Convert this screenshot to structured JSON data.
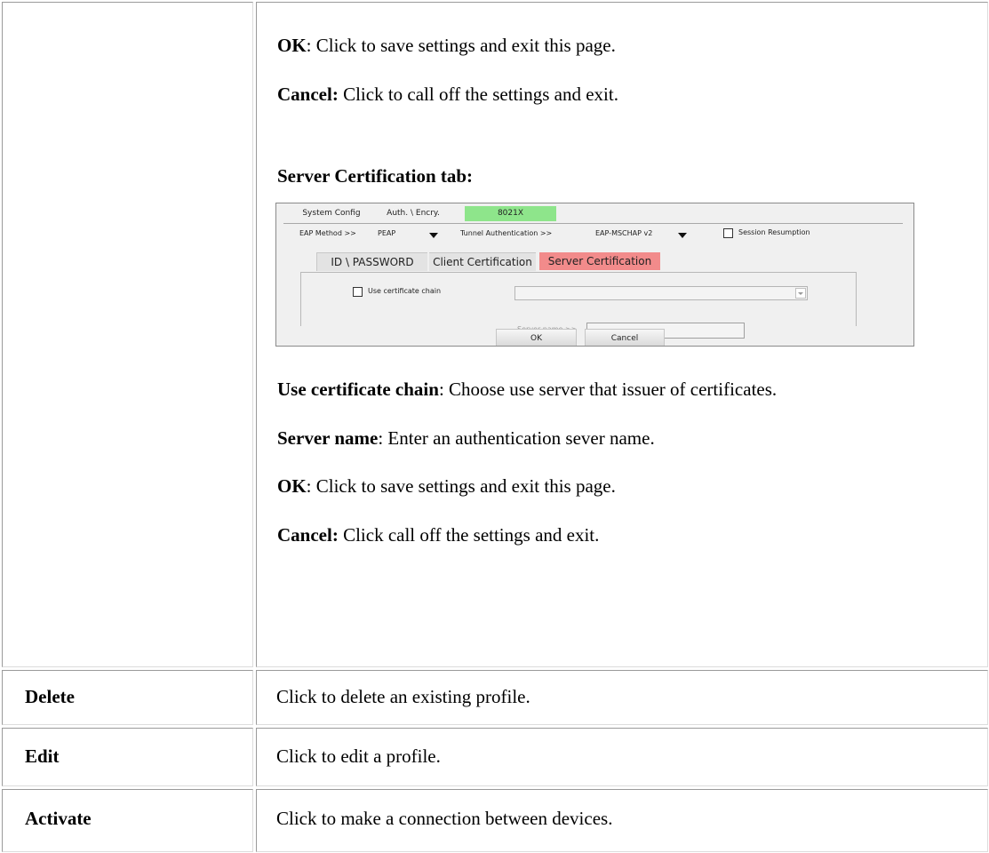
{
  "top_section": {
    "paragraphs": [
      {
        "term": "OK",
        "text": ": Click to save settings and exit this page."
      },
      {
        "term": "Cancel:",
        "text": " Click to call off the settings and exit."
      }
    ],
    "heading": "Server Certification tab:"
  },
  "dialog": {
    "tabs": [
      "System Config",
      "Auth. \\ Encry.",
      "8021X"
    ],
    "active_tab_color": "#8ee58b",
    "eap_method_label": "EAP Method >>",
    "eap_method_value": "PEAP",
    "tunnel_auth_label": "Tunnel Authentication >>",
    "tunnel_auth_value": "EAP-MSCHAP v2",
    "session_resumption_label": "Session Resumption",
    "sub_tabs": [
      "ID \\ PASSWORD",
      "Client Certification",
      "Server Certification"
    ],
    "active_sub_tab_color": "#f28b8b",
    "use_cert_chain_label": "Use certificate chain",
    "server_name_label": "Server name >>",
    "ok_label": "OK",
    "cancel_label": "Cancel"
  },
  "bottom_section": {
    "paragraphs": [
      {
        "term": "Use certificate chain",
        "text": ": Choose use server that issuer of certificates."
      },
      {
        "term": "Server name",
        "text": ": Enter an authentication sever name."
      },
      {
        "term": "OK",
        "text": ": Click to save settings and exit this page."
      },
      {
        "term": "Cancel:",
        "text": " Click call off the settings and exit."
      }
    ]
  },
  "rows": [
    {
      "label": "Delete",
      "description": "Click to delete an existing profile."
    },
    {
      "label": "Edit",
      "description": "Click to edit a profile."
    },
    {
      "label": "Activate",
      "description": "Click to make a connection between devices."
    }
  ]
}
